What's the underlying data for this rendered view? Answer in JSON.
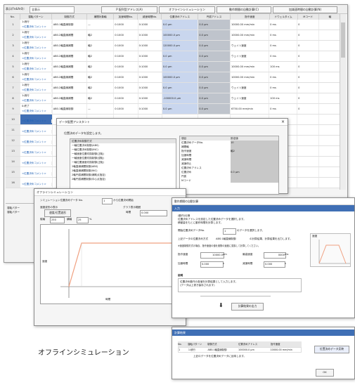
{
  "toolbar": {
    "display_label": "表示(Fn&fn0):",
    "display_value": "全表示",
    "btn1": "P 配列型アドレス(A)",
    "btn2": "オフラインシミュレーション",
    "btn3": "動作期間の自動計算(C)",
    "btn4": "加減速時間の自動計算(N)"
  },
  "grid": {
    "headers": [
      "No.",
      "運転パターン",
      "制御方式",
      "補間対象軸",
      "加速時間No.",
      "減速時間No.",
      "位置決めアドレス",
      "円弧アドレス",
      "指令速度",
      "ドウェルタイム",
      "Mコード",
      "軸"
    ],
    "rows": [
      {
        "no": "1",
        "pat": "1:続行",
        "sub": "<位置決めコメント>",
        "ctrl": "ABS:1軸直線制御",
        "interp": "—",
        "acc": "0:1000",
        "dec": "0:1000",
        "addr": "0.0 μm",
        "arc": "0.0 μm",
        "speed": "10000.00 mm/min",
        "dwell": "0 ms",
        "m": "0"
      },
      {
        "no": "2",
        "pat": "1:続行",
        "sub": "<位置決めコメント>",
        "ctrl": "ABS:2軸直線補間",
        "interp": "軸2",
        "acc": "0:1000",
        "dec": "0:1000",
        "addr": "100000.0 μm",
        "arc": "0.0 μm",
        "speed": "10000.00 mm/min",
        "dwell": "0 ms",
        "m": "0"
      },
      {
        "no": "3",
        "pat": "1:続行",
        "sub": "<位置決めコメント>",
        "ctrl": "ABS:2軸直線補間",
        "interp": "軸2",
        "acc": "0:1000",
        "dec": "0:1000",
        "addr": "120000.0 μm",
        "arc": "0.0 μm",
        "speed": "ウェイト速度",
        "dwell": "0 ms",
        "m": "0"
      },
      {
        "no": "4",
        "pat": "1:続行",
        "sub": "<位置決めコメント>",
        "ctrl": "ABS:2軸直線補間",
        "interp": "軸2",
        "acc": "0:1000",
        "dec": "0:1000",
        "addr": "0.0 μm",
        "arc": "0.0 μm",
        "speed": "ウェイト速度",
        "dwell": "0 ms",
        "m": "0"
      },
      {
        "no": "5",
        "pat": "1:続行",
        "sub": "<位置決めコメント>",
        "ctrl": "ABS:2軸直線補間",
        "interp": "軸2",
        "acc": "0:1000",
        "dec": "0:1000",
        "addr": "0.0 μm",
        "arc": "0.0 μm",
        "speed": "10000.00 mm/min",
        "dwell": "100 ms",
        "m": "0"
      },
      {
        "no": "6",
        "pat": "1:続行",
        "sub": "<位置決めコメント>",
        "ctrl": "ABS:2軸直線補間",
        "interp": "軸2",
        "acc": "0:1000",
        "dec": "0:1000",
        "addr": "100000.0 μm",
        "arc": "0.0 μm",
        "speed": "10000.00 mm/min",
        "dwell": "0 ms",
        "m": "0"
      },
      {
        "no": "7",
        "pat": "1:続行",
        "sub": "<位置決めコメント>",
        "ctrl": "ABS:2軸直線補間",
        "interp": "軸2",
        "acc": "0:1000",
        "dec": "0:1000",
        "addr": "0.0 μm",
        "arc": "0.0 μm",
        "speed": "ウェイト速度",
        "dwell": "0 ms",
        "m": "0"
      },
      {
        "no": "8",
        "pat": "1:続行",
        "sub": "<位置決めコメント>",
        "ctrl": "ABS:2軸直線補間",
        "interp": "軸2",
        "acc": "0:1000",
        "dec": "0:1000",
        "addr": "-100000.0 μm",
        "arc": "0.0 μm",
        "speed": "ウェイト速度",
        "dwell": "100 ms",
        "m": "0"
      },
      {
        "no": "9",
        "pat": "0:終了",
        "sub": "<位置決めコメント>",
        "ctrl": "ABS:1軸直線制御",
        "interp": "—",
        "acc": "0:1000",
        "dec": "0:1000",
        "addr": "0.0 μm",
        "arc": "0.0 μm",
        "speed": "6750.00 mm/min",
        "dwell": "0 ms",
        "m": "0"
      },
      {
        "no": "10",
        "pat": "",
        "sub": "<位置決めコメント>",
        "ctrl": "",
        "interp": "",
        "acc": "",
        "dec": "",
        "addr": "",
        "arc": "",
        "speed": "",
        "dwell": "",
        "m": ""
      },
      {
        "no": "11",
        "pat": "",
        "sub": "<位置決めコメント>",
        "ctrl": "",
        "interp": "",
        "acc": "",
        "dec": "",
        "addr": "",
        "arc": "",
        "speed": "",
        "dwell": "",
        "m": ""
      },
      {
        "no": "12",
        "pat": "",
        "sub": "<位置決めコメント>",
        "ctrl": "",
        "interp": "",
        "acc": "",
        "dec": "",
        "addr": "",
        "arc": "",
        "speed": "",
        "dwell": "",
        "m": ""
      },
      {
        "no": "13",
        "pat": "",
        "sub": "<位置決めコメント>",
        "ctrl": "",
        "interp": "",
        "acc": "",
        "dec": "",
        "addr": "",
        "arc": "",
        "speed": "",
        "dwell": "",
        "m": ""
      },
      {
        "no": "14",
        "pat": "",
        "sub": "<位置決めコメント>",
        "ctrl": "",
        "interp": "",
        "acc": "",
        "dec": "",
        "addr": "",
        "arc": "",
        "speed": "",
        "dwell": "",
        "m": ""
      },
      {
        "no": "15",
        "pat": "",
        "sub": "<位置決めコメント>",
        "ctrl": "",
        "interp": "",
        "acc": "",
        "dec": "",
        "addr": "",
        "arc": "",
        "speed": "",
        "dwell": "",
        "m": ""
      },
      {
        "no": "16",
        "pat": "",
        "sub": "<位置決めコメント>",
        "ctrl": "",
        "interp": "",
        "acc": "",
        "dec": "",
        "addr": "",
        "arc": "",
        "speed": "",
        "dwell": "",
        "m": ""
      }
    ]
  },
  "bottom_labels": [
    "運転パター",
    "運転パター"
  ],
  "dialog1": {
    "title": "データ配置アシスタント",
    "close": "×",
    "intro": "位置決めデータを設定します。",
    "list": [
      "位置決め制御方式",
      "一軸位置決め制御(ABS)",
      "一軸位置決め制御(INC)",
      "一軸速度位置切換制御(正転)",
      "一軸速度位置切換制御(逆転)",
      "一軸位置速度切換制御(正転)",
      "2軸直線補間制御(ABS)",
      "2軸直線補間制御(INC)",
      "2軸円弧補間制御(補助点指定)",
      "2軸円弧補間制御(中心点指定)"
    ],
    "table_head": [
      "項目",
      "設定値"
    ],
    "table_rows": [
      [
        "位置決めデータNo.",
        "10"
      ],
      [
        "補間軸",
        ""
      ],
      [
        "指令速度",
        "軸2"
      ],
      [
        "加速時間",
        ""
      ],
      [
        "減速時間",
        ""
      ],
      [
        "減速停止",
        ""
      ],
      [
        "位置決めアドレス",
        ""
      ],
      [
        "位置決め",
        "0.0 μm"
      ],
      [
        "円弧",
        ""
      ],
      [
        "Mコード",
        ""
      ]
    ]
  },
  "dialog2": {
    "title": "オフラインシミュレーション",
    "line1": "シミュレーション位置決めデータ No.",
    "line1_value": "1",
    "line1_suffix": "から位置決め開始",
    "left_group": "速度波形の表示",
    "left_opt": "速度/位置波形",
    "right_group": "グラフ表示範囲",
    "right_field1": "時間",
    "right_field2": "0.000",
    "field_a": "縦軸",
    "field_a_val": "250",
    "field_b": "横軸",
    "field_b_val": "25",
    "field_unit": "%",
    "plot_xlabel": "時間",
    "plot_ylabel": "速度"
  },
  "dialog3": {
    "title": "動作期間の自動計算",
    "bar1": "入力",
    "notes": [
      "(動作)仕様",
      "位置決めアドレスを設定した位置決めデータを選択します。",
      "移動量をもとに動作時間を計算します。"
    ],
    "field_no_label": "開始位置決めデータNo.",
    "field_no_val": "1",
    "field_no_suffix": "のデータを選択します。",
    "line2": "上記データの位置決め方式",
    "line2_val": "ABS:1軸直線制御",
    "line2_tail": "の計算結果、計算結果を出力します。",
    "line3": "※速度制御方式の場合、指令速度の値を実際の速度に変換して計算してください。",
    "label_a": "指令速度",
    "val_a": "10000.0",
    "unit_a": "μm",
    "label_b": "最高速度",
    "val_b": "0000",
    "unit_b": "ms",
    "label_c": "加速時間",
    "val_c": "0.000",
    "unit_c": "s",
    "label_d": "減速時間",
    "val_d": "0.000",
    "unit_d": "s",
    "section": "説明",
    "desc1": "位置決め動作の各値を計算結果として入力します。",
    "desc2": "(データは上書き保存されます)",
    "calc_button": "計算結果の出力",
    "graph_label": "速度",
    "graph_ticks": [
      "100000",
      "",
      "0.000"
    ]
  },
  "dialog4": {
    "bar": "計算結果",
    "head": [
      "No.",
      "運転パターン",
      "制御方式",
      "位置決めアドレス",
      "指令速度"
    ],
    "row": [
      "1",
      "1:続行",
      "ABS:1軸直線制御",
      "100000.0 μm",
      "10000.00 mm/min"
    ],
    "note": "上記のデータを位置決めデータに反映します。",
    "btn_apply": "位置決めデータ反映",
    "btn_ok": "OK"
  },
  "caption": "オフラインシミュレーション",
  "colors": {
    "accent": "#3f6fb5",
    "curve": "#f0a080"
  }
}
